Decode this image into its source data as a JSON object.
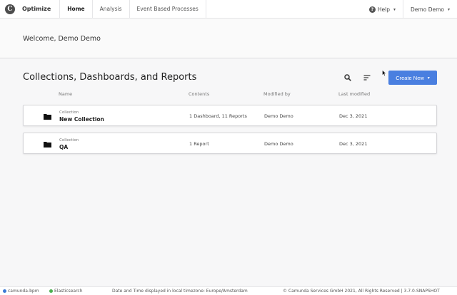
{
  "topbar": {
    "app_name": "Optimize",
    "nav": [
      "Home",
      "Analysis",
      "Event Based Processes"
    ],
    "help_label": "Help",
    "user_label": "Demo Demo"
  },
  "welcome": {
    "text": "Welcome, Demo Demo"
  },
  "main": {
    "title": "Collections, Dashboards, and Reports",
    "create_label": "Create New",
    "columns": [
      "Name",
      "Contents",
      "Modified by",
      "Last modified"
    ],
    "rows": [
      {
        "type": "Collection",
        "name": "New Collection",
        "contents": "1 Dashboard, 11 Reports",
        "modified_by": "Demo Demo",
        "last_modified": "Dec 3, 2021"
      },
      {
        "type": "Collection",
        "name": "QA",
        "contents": "1 Report",
        "modified_by": "Demo Demo",
        "last_modified": "Dec 3, 2021"
      }
    ]
  },
  "footer": {
    "engine": "camunda-bpm",
    "search": "Elasticsearch",
    "timezone": "Date and Time displayed in local timezone: Europe/Amsterdam",
    "copyright": "© Camunda Services GmbH 2021, All Rights Reserved | 3.7.0-SNAPSHOT",
    "engine_status_color": "#3c7ad6",
    "search_status_color": "#4caf50"
  },
  "colors": {
    "accent": "#4a7fe0"
  },
  "icons": [
    "camunda-logo-icon",
    "help-icon",
    "chevron-down-icon",
    "search-icon",
    "sort-icon",
    "folder-icon",
    "cursor-icon"
  ]
}
